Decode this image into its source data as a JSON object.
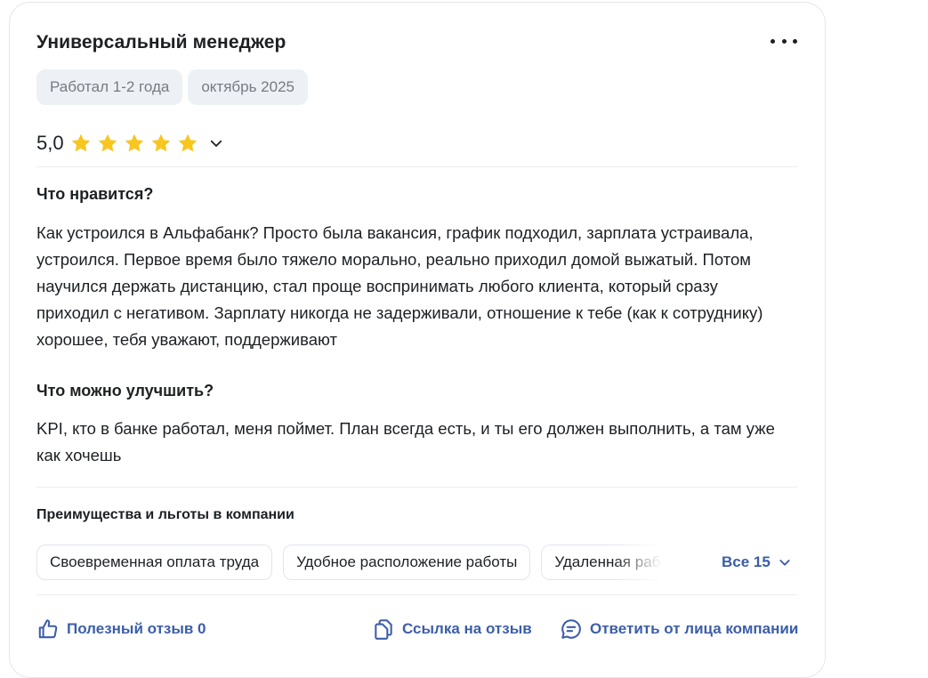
{
  "review": {
    "title": "Универсальный менеджер",
    "chips": [
      "Работал 1-2 года",
      "октябрь 2025"
    ],
    "rating": {
      "value_text": "5,0",
      "stars": 5,
      "max": 5
    },
    "likes": {
      "heading": "Что нравится?",
      "text": "Как устроился в Альфабанк? Просто была вакансия, график подходил, зарплата устраивала, устроился. Первое время было тяжело морально, реально приходил домой выжатый. Потом научился держать дистанцию, стал проще воспринимать любого клиента, который сразу приходил с негативом. Зарплату никогда не задерживали, отношение к тебе (как к сотруднику) хорошее, тебя уважают, поддерживают"
    },
    "improve": {
      "heading": "Что можно улучшить?",
      "text": "KPI, кто в банке работал, меня поймет. План всегда есть, и ты его должен выполнить, а там уже как хочешь"
    },
    "benefits": {
      "heading": "Преимущества и льготы в компании",
      "items": [
        "Своевременная оплата труда",
        "Удобное расположение работы",
        "Удаленная работа"
      ],
      "all_label": "Все 15"
    },
    "actions": {
      "helpful_label": "Полезный отзыв 0",
      "link_label": "Ссылка на отзыв",
      "reply_label": "Ответить от лица компании"
    }
  },
  "colors": {
    "star": "#f9c51f",
    "link": "#3c5ea8",
    "chip_bg": "#edf0f5",
    "chip_text": "#767b84"
  },
  "icons": [
    "more-dots-icon",
    "star-icon",
    "chevron-down-icon",
    "thumbs-up-icon",
    "copy-link-icon",
    "comment-icon"
  ]
}
